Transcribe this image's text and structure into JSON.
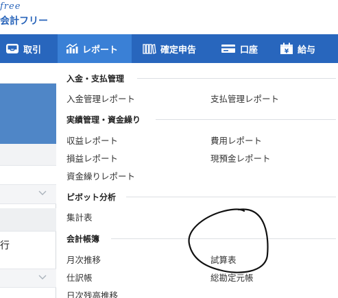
{
  "header": {
    "logo_script": "free",
    "logo_text": "会計フリー"
  },
  "nav": {
    "items": [
      {
        "label": "取引",
        "icon": "inbox-icon"
      },
      {
        "label": "レポート",
        "icon": "bar-chart-icon"
      },
      {
        "label": "確定申告",
        "icon": "books-icon"
      },
      {
        "label": "口座",
        "icon": "card-icon"
      },
      {
        "label": "給与",
        "icon": "calendar-yen-icon"
      }
    ],
    "active_index": 1
  },
  "left_panel": {
    "text_fragment": "行"
  },
  "report_menu": {
    "sections": [
      {
        "title": "入金・支払管理",
        "left": [
          "入金管理レポート"
        ],
        "right": [
          "支払管理レポート"
        ]
      },
      {
        "title": "実績管理・資金繰り",
        "left": [
          "収益レポート",
          "損益レポート",
          "資金繰りレポート"
        ],
        "right": [
          "費用レポート",
          "現預金レポート"
        ]
      },
      {
        "title": "ピボット分析",
        "left": [
          "集計表"
        ],
        "right": []
      },
      {
        "title": "会計帳簿",
        "left": [
          "月次推移",
          "仕訳帳",
          "日次残高推移"
        ],
        "right": [
          "試算表",
          "総勘定元帳"
        ]
      }
    ]
  },
  "colors": {
    "nav_bg": "#2866bd",
    "nav_active": "#3a80d6",
    "brand": "#2864ba"
  }
}
